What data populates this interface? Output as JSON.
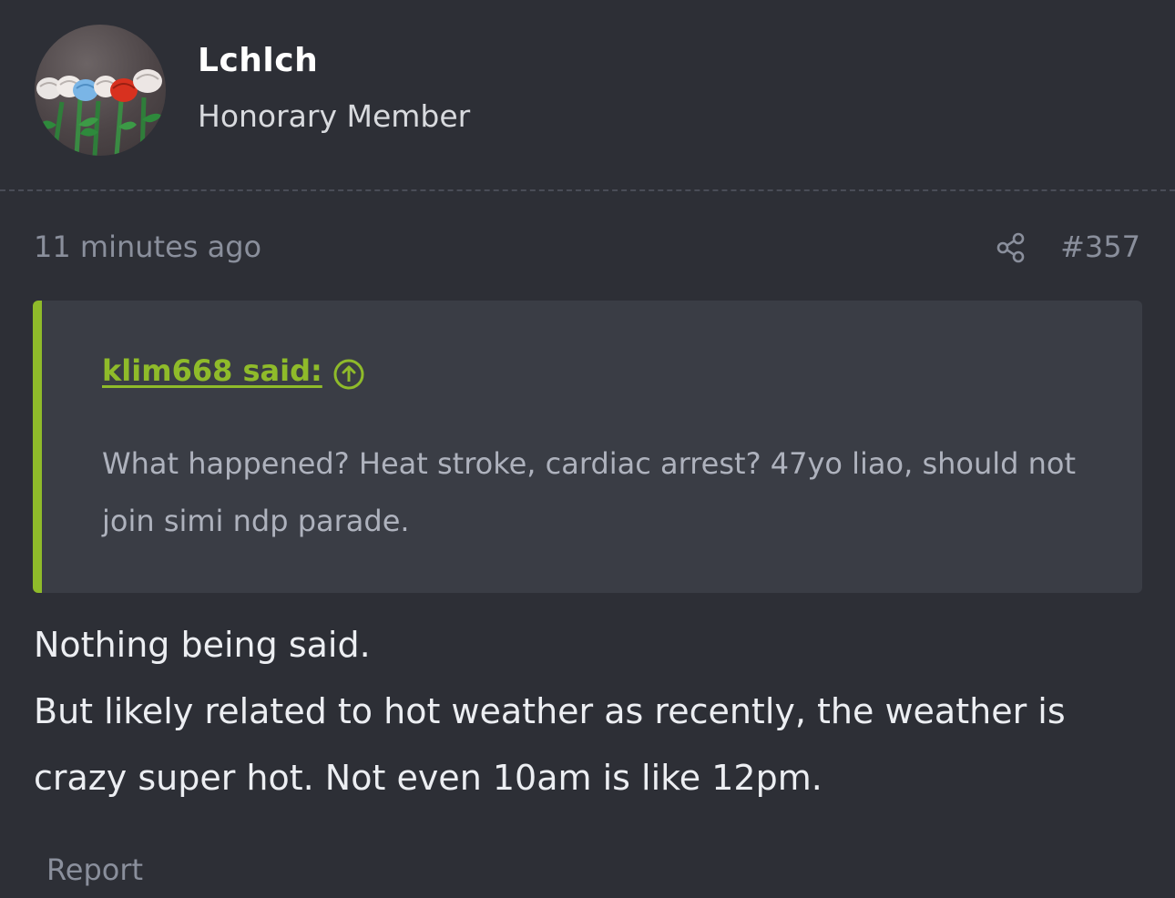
{
  "user": {
    "name": "Lchlch",
    "title": "Honorary Member"
  },
  "post": {
    "time_ago": "11 minutes ago",
    "number": "#357",
    "quote": {
      "author_label": "klim668 said:",
      "text": "What happened? Heat stroke, cardiac arrest? 47yo liao, should not join simi ndp parade."
    },
    "body_lines": [
      "Nothing being said.",
      "But likely related to hot weather as recently, the weather is crazy super hot. Not even 10am is like 12pm."
    ],
    "report_label": "Report"
  },
  "colors": {
    "background": "#2d2f36",
    "quote_background": "#3a3d45",
    "accent": "#8fbb2a",
    "muted_text": "#8a8f9c"
  },
  "icons": {
    "share": "share-icon",
    "quote_jump": "arrow-up-circle-icon",
    "avatar": "roses-avatar"
  }
}
